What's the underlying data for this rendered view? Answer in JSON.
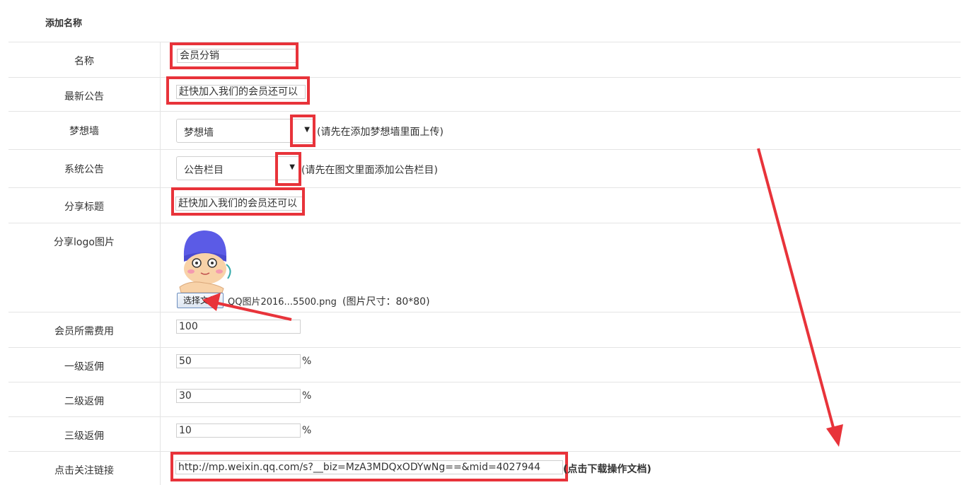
{
  "header": {
    "title": "添加名称"
  },
  "form": {
    "name": {
      "label": "名称",
      "value": "会员分销"
    },
    "notice": {
      "label": "最新公告",
      "value": "赶快加入我们的会员还可以"
    },
    "dream_wall": {
      "label": "梦想墙",
      "selected": "梦想墙",
      "hint": "(请先在添加梦想墙里面上传)"
    },
    "system_notice": {
      "label": "系统公告",
      "selected": "公告栏目",
      "hint": "(请先在图文里面添加公告栏目)"
    },
    "share_title": {
      "label": "分享标题",
      "value": "赶快加入我们的会员还可以"
    },
    "share_logo": {
      "label": "分享logo图片",
      "button": "选择文件",
      "filename": "QQ图片2016...5500.png",
      "size_hint": "(图片尺寸：80*80)"
    },
    "member_fee": {
      "label": "会员所需费用",
      "value": "100"
    },
    "level1": {
      "label": "一级返佣",
      "value": "50",
      "unit": "%"
    },
    "level2": {
      "label": "二级返佣",
      "value": "30",
      "unit": "%"
    },
    "level3": {
      "label": "三级返佣",
      "value": "10",
      "unit": "%"
    },
    "follow_link": {
      "label": "点击关注链接",
      "value": "http://mp.weixin.qq.com/s?__biz=MzA3MDQxODYwNg==&mid=4027944",
      "help": "(点击下载操作文档)"
    }
  },
  "icons": {
    "select_arrow": "triangle-down-icon",
    "avatar": "cartoon-avatar-icon"
  },
  "colors": {
    "highlight": "#e8333a",
    "border": "#e4e4e4"
  }
}
